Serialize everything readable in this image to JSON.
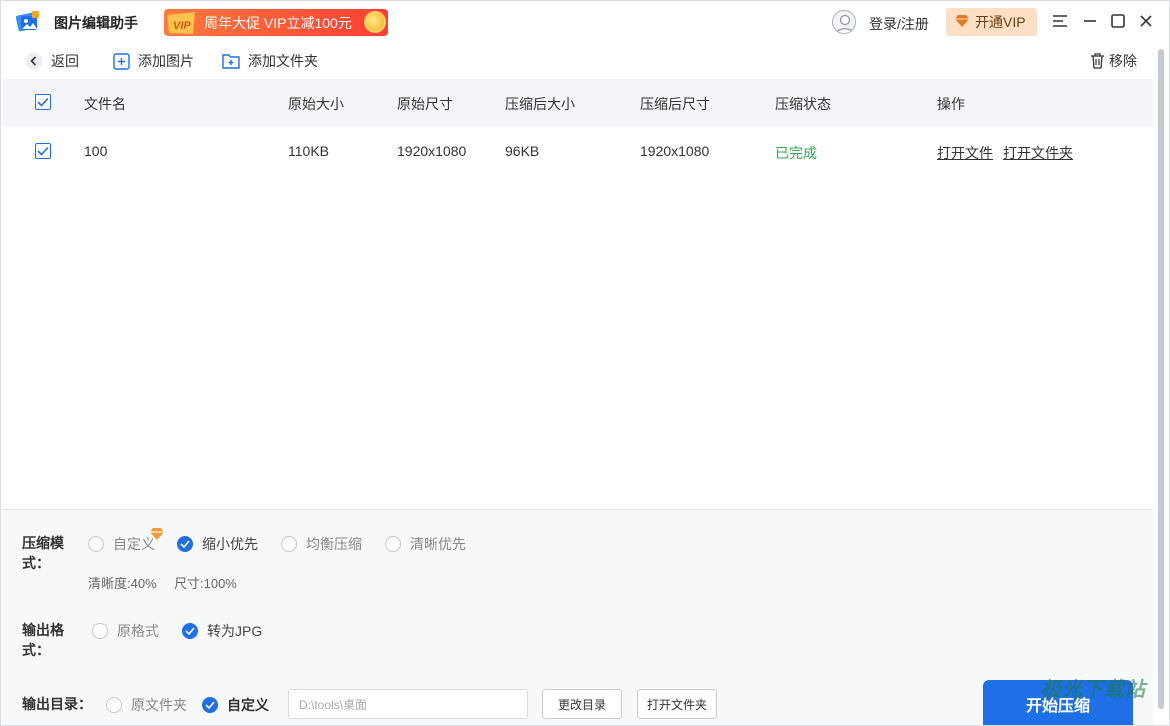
{
  "app": {
    "title": "图片编辑助手"
  },
  "promo": {
    "text": "周年大促 VIP立减100元",
    "badge": "VIP"
  },
  "header": {
    "login_label": "登录/注册",
    "vip_label": "开通VIP"
  },
  "toolbar": {
    "back_label": "返回",
    "add_image_label": "添加图片",
    "add_folder_label": "添加文件夹",
    "remove_label": "移除"
  },
  "table": {
    "headers": [
      "文件名",
      "原始大小",
      "原始尺寸",
      "压缩后大小",
      "压缩后尺寸",
      "压缩状态",
      "操作"
    ],
    "rows": [
      {
        "name": "100",
        "orig_size": "110KB",
        "orig_dim": "1920x1080",
        "comp_size": "96KB",
        "comp_dim": "1920x1080",
        "status": "已完成",
        "action_open_file": "打开文件",
        "action_open_folder": "打开文件夹",
        "checked": true
      }
    ]
  },
  "settings": {
    "mode_label": "压缩模式：",
    "mode_options": [
      "自定义",
      "缩小优先",
      "均衡压缩",
      "清晰优先"
    ],
    "mode_selected": "缩小优先",
    "clarity_text": "清晰度:40%",
    "size_text": "尺寸:100%",
    "format_label": "输出格式：",
    "format_options": [
      "原格式",
      "转为JPG"
    ],
    "format_selected": "转为JPG",
    "dir_label": "输出目录：",
    "dir_options": [
      "原文件夹",
      "自定义"
    ],
    "dir_selected": "自定义",
    "dir_path": "D:\\tools\\桌面",
    "change_dir_label": "更改目录",
    "open_folder_label": "打开文件夹",
    "start_label": "开始压缩"
  },
  "watermark": {
    "text": "极光下载站"
  },
  "colors": {
    "accent": "#1f6fe6",
    "status_done": "#2fa84f",
    "vip_bg": "#fde0c4",
    "promo_red": "#ff3e35"
  }
}
